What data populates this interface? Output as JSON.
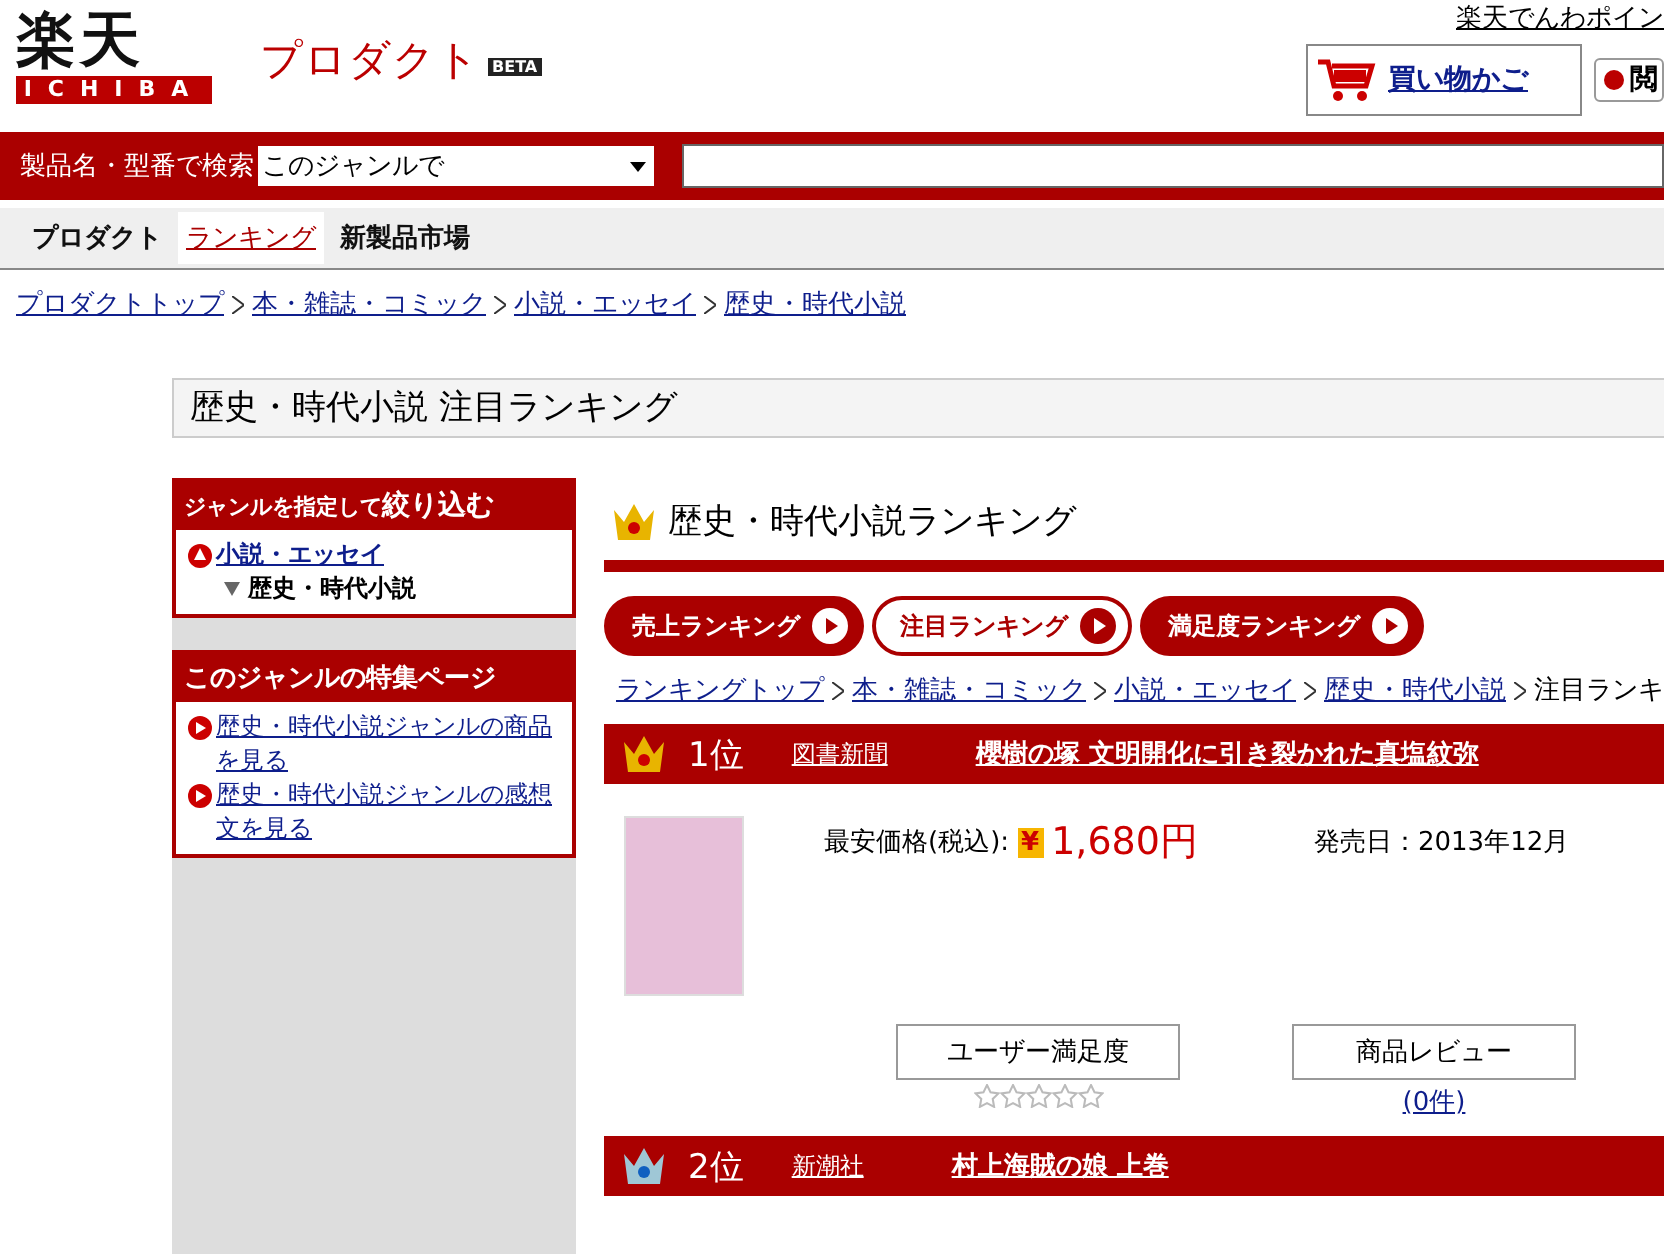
{
  "header": {
    "logo": "楽天",
    "logo_sub": "ICHIBA",
    "product_title": "プロダクト",
    "beta_badge": "BETA",
    "top_link": "楽天でんわポイン",
    "cart": "買い物かご",
    "history_button": "閲"
  },
  "search": {
    "label": "製品名・型番で検索",
    "scope": "このジャンルで"
  },
  "nav": [
    {
      "label": "プロダクト",
      "selected": false
    },
    {
      "label": "ランキング",
      "selected": true
    },
    {
      "label": "新製品市場",
      "selected": false
    }
  ],
  "breadcrumb": [
    "プロダクトトップ",
    "本・雑誌・コミック",
    "小説・エッセイ",
    "歴史・時代小説"
  ],
  "page_title": "歴史・時代小説 注目ランキング",
  "sidebar": {
    "narrow_title_prefix": "ジャンルを指定して",
    "narrow_title_emphasis": "絞り込む",
    "genre_parent": "小説・エッセイ",
    "genre_current": "歴史・時代小説",
    "feature_title": "このジャンルの特集ページ",
    "feature_links": [
      "歴史・時代小説ジャンルの商品を見る",
      "歴史・時代小説ジャンルの感想文を見る"
    ]
  },
  "ranking_title": "歴史・時代小説ランキング",
  "ranking_tabs": [
    {
      "label": "売上ランキング",
      "selected": false
    },
    {
      "label": "注目ランキング",
      "selected": true
    },
    {
      "label": "満足度ランキング",
      "selected": false
    }
  ],
  "ranking_breadcrumb": [
    "ランキングトップ",
    "本・雑誌・コミック",
    "小説・エッセイ",
    "歴史・時代小説"
  ],
  "ranking_breadcrumb_current": "注目ランキ",
  "items": [
    {
      "rank": "1位",
      "color": "#e8b400",
      "publisher": "図書新聞",
      "title": "櫻樹の塚 文明開化に引き裂かれた真塩紋弥",
      "price_label": "最安価格(税込):",
      "yen": "¥",
      "price": "1,680円",
      "release": "発売日：2013年12月",
      "satisfaction_label": "ユーザー満足度",
      "stars": 0,
      "review_label": "商品レビュー",
      "review_count": "(0件)"
    },
    {
      "rank": "2位",
      "color": "#9fc7d6",
      "publisher": "新潮社",
      "title": "村上海賊の娘 上巻"
    }
  ]
}
